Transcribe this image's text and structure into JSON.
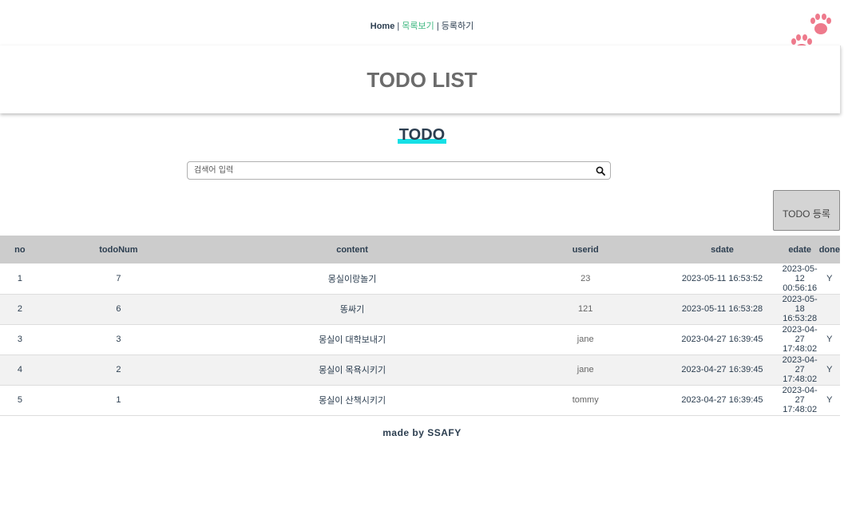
{
  "nav": {
    "home": "Home",
    "sep1": "|",
    "list": "목록보기",
    "sep2": "|",
    "register": "등록하기"
  },
  "header": {
    "title": "TODO LIST"
  },
  "section": {
    "title": "TODO"
  },
  "search": {
    "placeholder": "검색어 입력",
    "value": ""
  },
  "register_button": {
    "label": "TODO 등록"
  },
  "table": {
    "headers": [
      "no",
      "todoNum",
      "content",
      "userid",
      "sdate",
      "edate",
      "done"
    ],
    "rows": [
      {
        "no": "1",
        "todoNum": "7",
        "content": "몽실이랑놀기",
        "userid": "23",
        "sdate": "2023-05-11 16:53:52",
        "edate": "2023-05-12 00:56:16",
        "done": "Y"
      },
      {
        "no": "2",
        "todoNum": "6",
        "content": "똥싸기",
        "userid": "121",
        "sdate": "2023-05-11 16:53:28",
        "edate": "2023-05-18 16:53:28",
        "done": ""
      },
      {
        "no": "3",
        "todoNum": "3",
        "content": "몽실이 대학보내기",
        "userid": "jane",
        "sdate": "2023-04-27 16:39:45",
        "edate": "2023-04-27 17:48:02",
        "done": "Y"
      },
      {
        "no": "4",
        "todoNum": "2",
        "content": "몽실이 목욕시키기",
        "userid": "jane",
        "sdate": "2023-04-27 16:39:45",
        "edate": "2023-04-27 17:48:02",
        "done": "Y"
      },
      {
        "no": "5",
        "todoNum": "1",
        "content": "몽실이 산책시키기",
        "userid": "tommy",
        "sdate": "2023-04-27 16:39:45",
        "edate": "2023-04-27 17:48:02",
        "done": "Y"
      }
    ]
  },
  "footer": {
    "text": "made by SSAFY"
  },
  "colors": {
    "accent_green": "#42b983",
    "underline_cyan": "#16e0e6",
    "paw_pink": "#ee7a8c",
    "header_gray": "#cccccc"
  },
  "icons": {
    "paws": "paw-prints-icon",
    "search": "search-icon"
  }
}
